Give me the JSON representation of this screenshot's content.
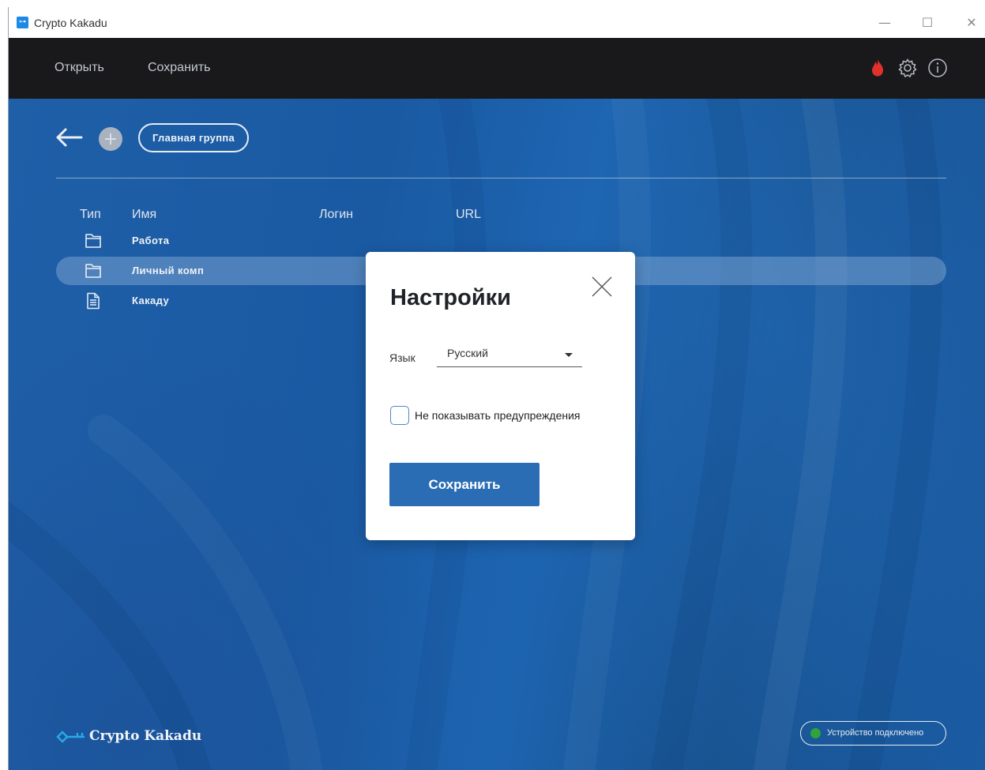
{
  "window": {
    "title": "Crypto Kakadu",
    "minimize_glyph": "—",
    "maximize_glyph": "☐",
    "close_glyph": "✕"
  },
  "menu": {
    "open_label": "Открыть",
    "save_label": "Сохранить",
    "icons": [
      "flame-icon",
      "gear-icon",
      "info-icon"
    ],
    "flame_color": "#e0312b"
  },
  "nav": {
    "group_label": "Главная группа"
  },
  "table": {
    "columns": {
      "type": "Тип",
      "name": "Имя",
      "login": "Логин",
      "url": "URL"
    },
    "rows": [
      {
        "icon": "folder-icon",
        "name": "Работа",
        "selected": false
      },
      {
        "icon": "folder-icon",
        "name": "Личный комп",
        "selected": true
      },
      {
        "icon": "document-icon",
        "name": "Какаду",
        "selected": false
      }
    ]
  },
  "footer": {
    "logo_text": "Crypto Kakadu",
    "status_text": "Устройство подключено",
    "status_color": "#2ea43a"
  },
  "dialog": {
    "title": "Настройки",
    "language_label": "Язык",
    "language_value": "Русский",
    "warnings_checkbox_label": "Не показывать предупреждения",
    "warnings_checked": false,
    "save_label": "Сохранить"
  },
  "colors": {
    "accent": "#2a6db5",
    "menubar": "#19191c",
    "background": "#1d5ea8"
  }
}
